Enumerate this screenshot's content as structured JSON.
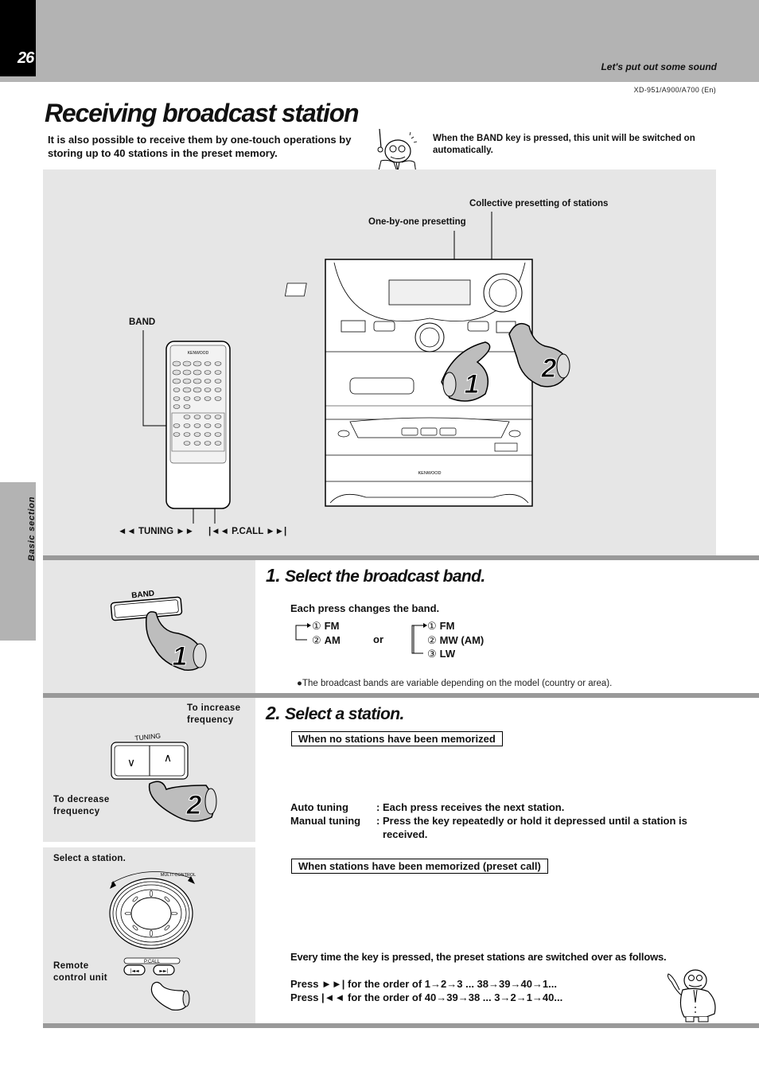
{
  "header": {
    "page_number": "26",
    "running_head": "Let's put out some sound",
    "model_id": "XD-951/A900/A700 (En)"
  },
  "side_tab": {
    "label": "Basic section"
  },
  "title": "Receiving broadcast station",
  "intro": {
    "left": "It is also possible to receive them by one-touch operations by storing up to 40 stations in the preset memory.",
    "right": "When the BAND key is pressed, this unit will be switched on automatically."
  },
  "figure": {
    "callouts": {
      "collective": "Collective presetting of stations",
      "one_by_one": "One-by-one presetting",
      "band": "BAND",
      "tuning": "◄◄  TUNING  ►►",
      "pcall": "|◄◄ P.CALL ►►|"
    },
    "remote_brand": "KENWOOD",
    "unit_brand": "KENWOOD",
    "hand_labels": [
      "1",
      "2"
    ]
  },
  "step1": {
    "number": "1.",
    "heading": "Select the broadcast band.",
    "key_label": "BAND",
    "hand_label": "1",
    "intro": "Each press changes the band.",
    "cycle_a": [
      {
        "n": "①",
        "label": "FM"
      },
      {
        "n": "②",
        "label": "AM"
      }
    ],
    "or": "or",
    "cycle_b": [
      {
        "n": "①",
        "label": "FM"
      },
      {
        "n": "②",
        "label": "MW (AM)"
      },
      {
        "n": "③",
        "label": "LW"
      }
    ],
    "note": "●The broadcast bands are variable depending on the model (country or area)."
  },
  "step2": {
    "number": "2.",
    "heading": "Select a station.",
    "tuning_panel": {
      "increase": "To increase frequency",
      "decrease": "To decrease frequency",
      "key_label": "TUNING",
      "down_glyph": "∨",
      "up_glyph": "∧",
      "hand_label": "2"
    },
    "no_memory_box": "When no stations have been memorized",
    "tuning_modes": [
      {
        "term": "Auto tuning",
        "desc": "Each press receives the next station."
      },
      {
        "term": "Manual tuning",
        "desc": "Press the key repeatedly or hold it depressed until a station is received."
      }
    ],
    "preset_panel": {
      "select_label": "Select a station.",
      "dial_label": "MULTI CONTROL",
      "remote_label": "Remote control unit",
      "pcall_label": "P.CALL",
      "prev_glyph": "|◄◄",
      "next_glyph": "►►|"
    },
    "memorized_box": "When stations have been memorized (preset call)",
    "switch_text": "Every time the key is pressed, the preset stations are switched over as follows.",
    "press_next": "Press ►►| for the order of 1→2→3 ... 38→39→40→1...",
    "press_prev": "Press |◄◄ for the order of 40→39→38 ... 3→2→1→40..."
  },
  "colors": {
    "header_gray": "#b3b3b3",
    "panel_gray": "#e6e6e6",
    "divider_gray": "#999999",
    "tab_black": "#000000"
  }
}
